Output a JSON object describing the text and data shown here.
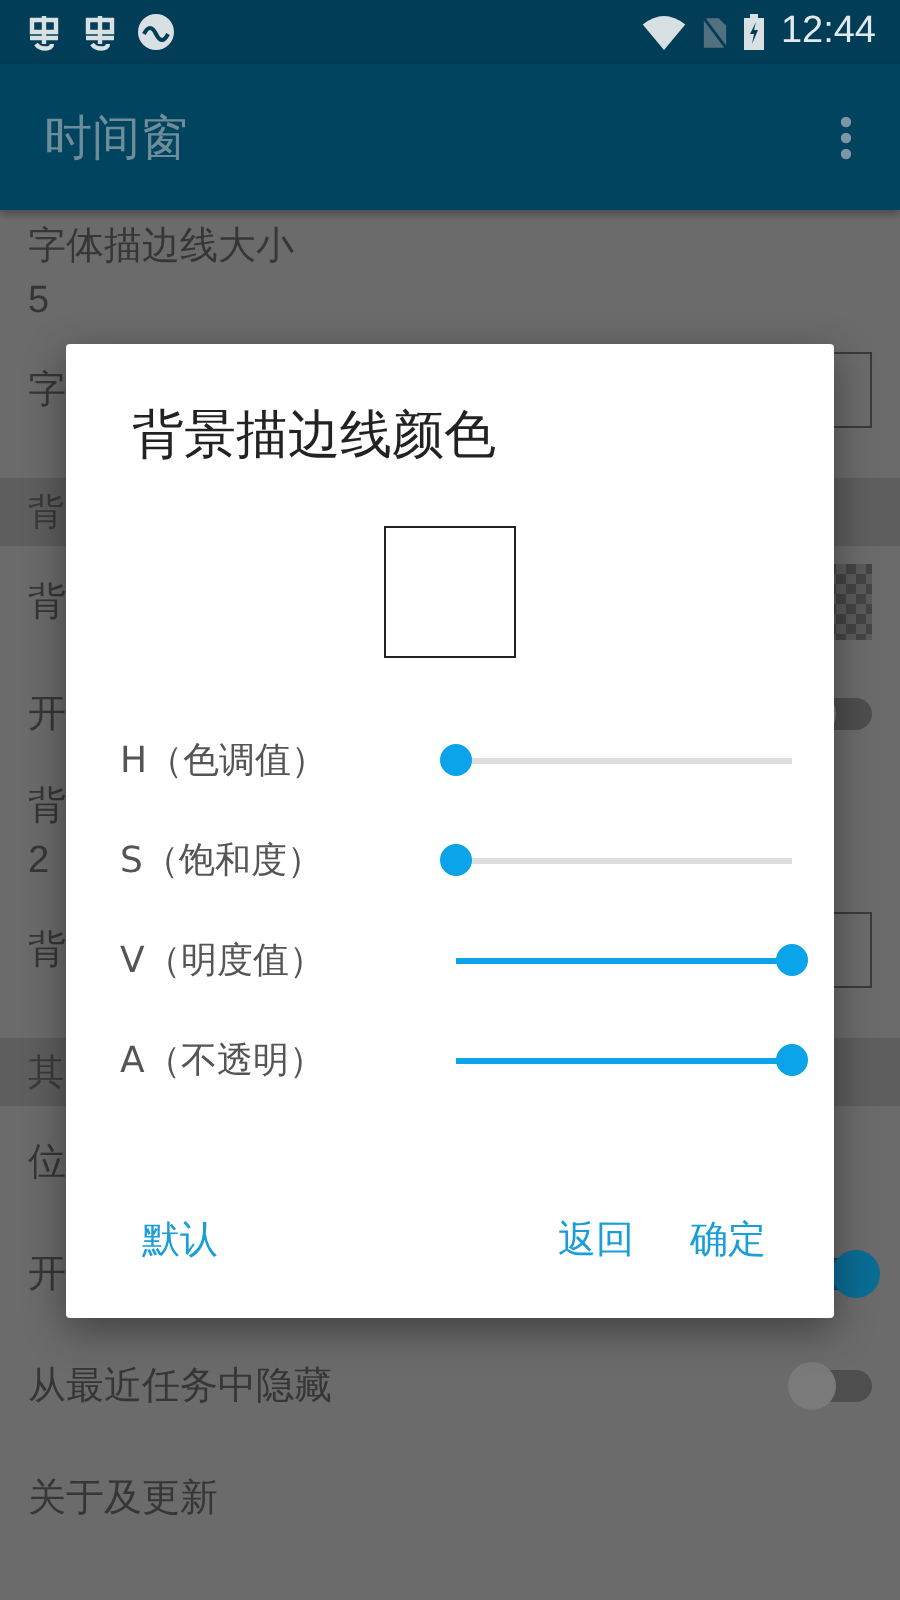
{
  "status_bar": {
    "time": "12:44"
  },
  "app_bar": {
    "title": "时间窗"
  },
  "settings": [
    {
      "kind": "item",
      "title": "字体描边线大小",
      "value": "5"
    },
    {
      "kind": "box",
      "title": "字"
    },
    {
      "kind": "header",
      "title": "背"
    },
    {
      "kind": "checker",
      "title": "背"
    },
    {
      "kind": "switch",
      "title": "开",
      "on": false
    },
    {
      "kind": "item",
      "title": "背",
      "value": "2"
    },
    {
      "kind": "box",
      "title": "背"
    },
    {
      "kind": "header",
      "title": "其"
    },
    {
      "kind": "item",
      "title": "位"
    },
    {
      "kind": "switch",
      "title": "开",
      "on": true
    },
    {
      "kind": "switch",
      "title": "从最近任务中隐藏",
      "on": false
    },
    {
      "kind": "item",
      "title": "关于及更新"
    }
  ],
  "dialog": {
    "title": "背景描边线颜色",
    "sliders": [
      {
        "label": "H（色调值）",
        "level": 0
      },
      {
        "label": "S（饱和度）",
        "level": 0
      },
      {
        "label": "V（明度值）",
        "level": 1
      },
      {
        "label": "A（不透明）",
        "level": 1
      }
    ],
    "neutral_button": {
      "label": "默认"
    },
    "buttons": [
      {
        "label": "返回"
      },
      {
        "label": "确定"
      }
    ]
  }
}
